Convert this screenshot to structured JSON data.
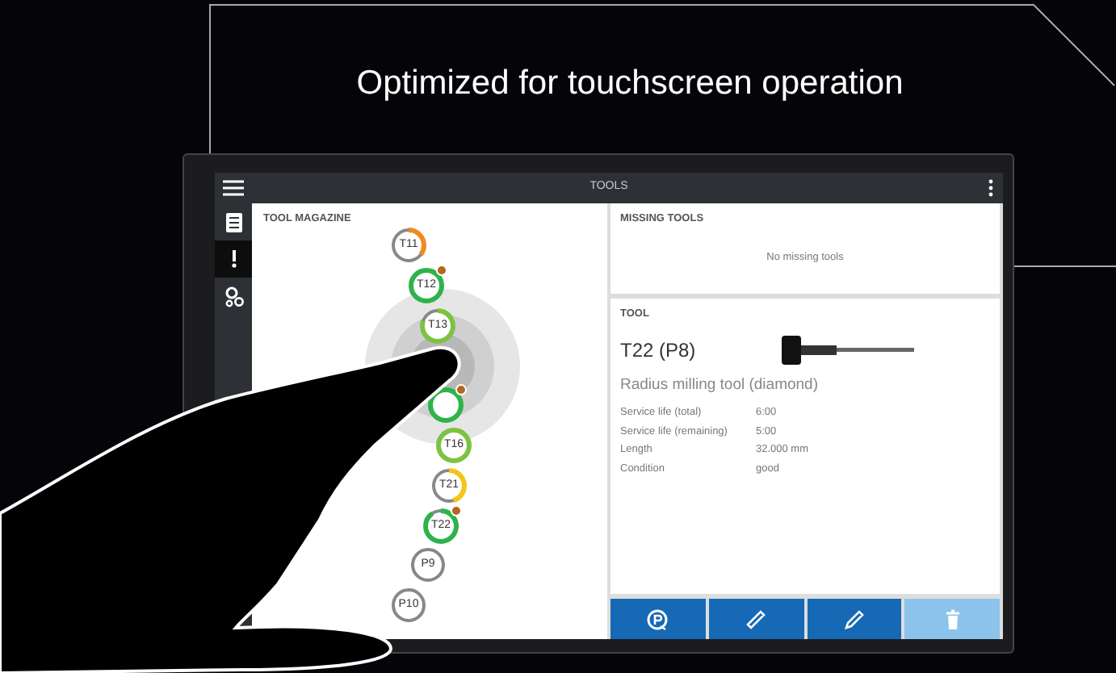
{
  "headline": "Optimized for touchscreen operation",
  "app": {
    "title": "TOOLS",
    "sidebar": [
      {
        "kind": "list",
        "selected": false
      },
      {
        "kind": "tool",
        "selected": true
      },
      {
        "kind": "gears",
        "selected": false
      }
    ],
    "magazine": {
      "title": "TOOL MAGAZINE",
      "tools": [
        {
          "label": "T11",
          "color": "#f08a24",
          "level": 0.35,
          "badge": false
        },
        {
          "label": "T12",
          "color": "#2db34a",
          "level": 1,
          "badge": true
        },
        {
          "label": "T13",
          "color": "#7dc242",
          "level": 0.8,
          "badge": false
        },
        {
          "color": "#2db34a",
          "level": 1,
          "badge": true
        },
        {
          "label": "T16",
          "color": "#7dc242",
          "level": 1,
          "badge": false
        },
        {
          "label": "T21",
          "color": "#f5c518",
          "level": 0.45,
          "badge": false
        },
        {
          "label": "T22",
          "color": "#2db34a",
          "level": 0.9,
          "badge": true
        },
        {
          "label": "P9",
          "badge": false
        },
        {
          "label": "P10",
          "badge": false
        }
      ]
    },
    "missing": {
      "title": "MISSING TOOLS",
      "message": "No missing tools"
    },
    "tool": {
      "title": "TOOL",
      "name": "T22 (P8)",
      "description": "Radius milling tool (diamond)",
      "properties": [
        {
          "label": "Service life (total)",
          "value": "6:00"
        },
        {
          "label": "Service life (remaining)",
          "value": "5:00"
        },
        {
          "label": "Length",
          "value": "32.000 mm"
        },
        {
          "label": "Condition",
          "value": "good"
        }
      ]
    },
    "actions": [
      {
        "kind": "reset",
        "disabled": false
      },
      {
        "kind": "ruler",
        "disabled": false
      },
      {
        "kind": "pencil",
        "disabled": false
      },
      {
        "kind": "trash",
        "disabled": true
      }
    ]
  }
}
